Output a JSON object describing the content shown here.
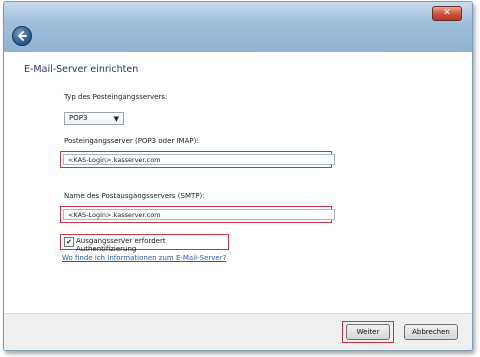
{
  "window": {
    "close_glyph": "✕",
    "back_icon": "back-arrow-icon"
  },
  "page": {
    "title": "E-Mail-Server einrichten"
  },
  "incoming_type": {
    "label": "Typ des Posteingangsservers:",
    "selected": "POP3",
    "arrow": "▼"
  },
  "incoming_server": {
    "label": "Posteingangsserver (POP3 oder IMAP):",
    "value": "<KAS-Login>.kasserver.com"
  },
  "outgoing_server": {
    "label": "Name des Postausgangsservers (SMTP):",
    "value": "<KAS-Login>.kasserver.com"
  },
  "auth_checkbox": {
    "label": "Ausgangsserver erfordert Authentifizierung",
    "checked": true,
    "mark": "✔"
  },
  "help_link": "Wo finde ich Informationen zum E-Mail-Server?",
  "footer": {
    "next_label": "Weiter",
    "cancel_label": "Abbrechen"
  },
  "colors": {
    "highlight": "#cc3344",
    "link": "#2a5cb8",
    "title": "#1e3a6e"
  }
}
